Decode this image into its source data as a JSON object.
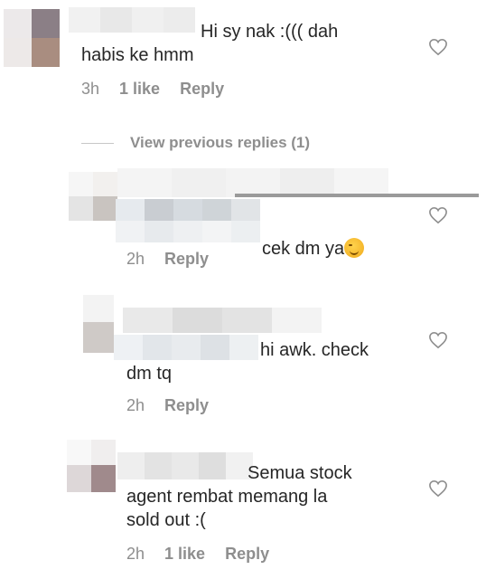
{
  "comments": [
    {
      "text": "Hi sy nak :((( dah\nhabis ke hmm",
      "time": "3h",
      "likes": "1 like",
      "reply": "Reply"
    },
    {
      "text": "cek dm ya",
      "time": "2h",
      "reply": "Reply"
    },
    {
      "text": "hi awk. check\ndm tq",
      "time": "2h",
      "reply": "Reply"
    },
    {
      "text": "Semua stock\nagent rembat memang la\nsold out :(",
      "time": "2h",
      "likes": "1 like",
      "reply": "Reply"
    }
  ],
  "view_previous": "View previous replies (1)",
  "icons": {
    "like": "heart-outline-icon",
    "emoji": "winking-face-emoji"
  }
}
